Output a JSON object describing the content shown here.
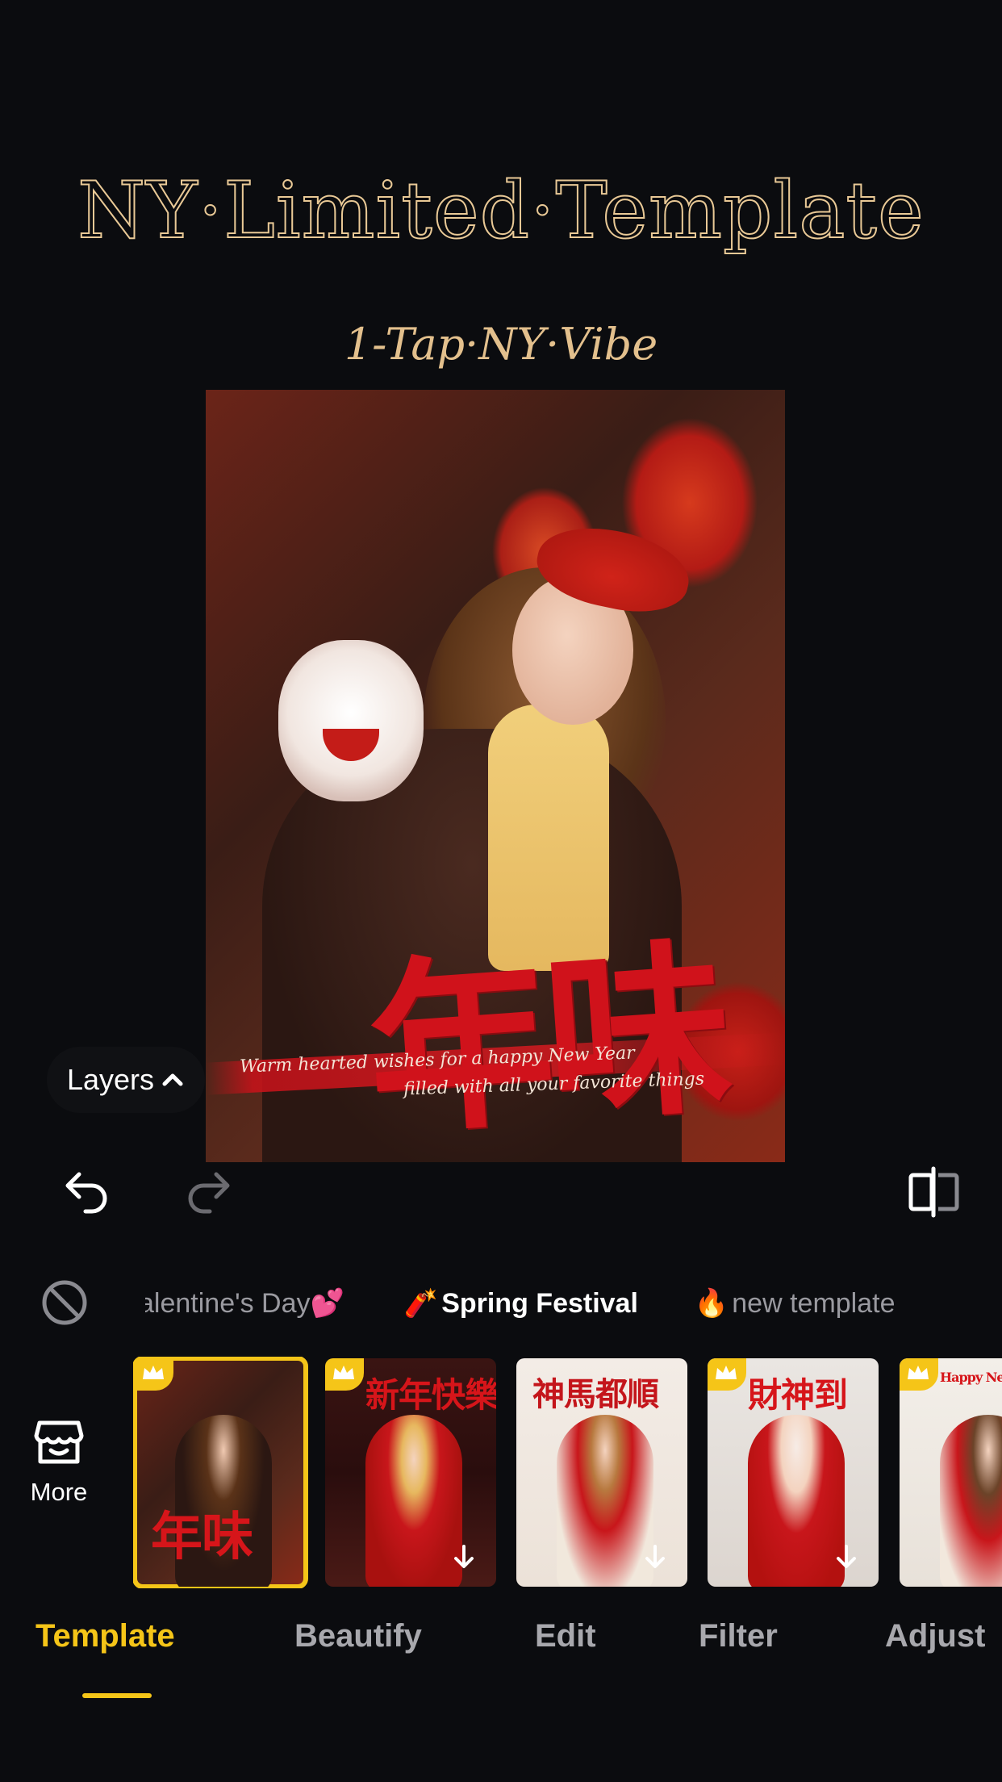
{
  "header": {
    "title": "NY·Limited·Template",
    "subtitle": "1-Tap·NY·Vibe"
  },
  "preview": {
    "calligraphy": "年味",
    "script_line_1": "Warm hearted wishes for a happy New Year",
    "script_line_2": "filled with all your favorite things"
  },
  "layers_button": {
    "label": "Layers",
    "icon": "chevron-up-icon"
  },
  "toolbar": {
    "undo_icon": "undo-icon",
    "redo_icon": "redo-icon",
    "compare_icon": "compare-icon"
  },
  "categories": {
    "none_icon": "no-filter-icon",
    "items": [
      {
        "label": "alentine's Day",
        "emoji": "💕",
        "emoji_position": "after"
      },
      {
        "label": "Spring Festival",
        "emoji": "🧨",
        "emoji_position": "before",
        "active": true
      },
      {
        "label": "new template",
        "emoji": "🔥",
        "emoji_position": "before"
      }
    ]
  },
  "templates": {
    "more_label": "More",
    "more_icon": "store-icon",
    "items": [
      {
        "title": "年味",
        "selected": true,
        "premium": true,
        "downloaded": true
      },
      {
        "title": "新年快樂",
        "selected": false,
        "premium": true,
        "downloaded": false
      },
      {
        "title": "神馬都順",
        "selected": false,
        "premium": false,
        "downloaded": false
      },
      {
        "title": "財神到",
        "selected": false,
        "premium": true,
        "downloaded": false
      },
      {
        "title": "Happy New Year!!",
        "selected": false,
        "premium": true,
        "downloaded": true
      }
    ]
  },
  "tabs": [
    {
      "label": "Template",
      "active": true
    },
    {
      "label": "Beautify",
      "active": false
    },
    {
      "label": "Edit",
      "active": false
    },
    {
      "label": "Filter",
      "active": false
    },
    {
      "label": "Adjust",
      "active": false
    }
  ],
  "colors": {
    "accent": "#f5c518",
    "background": "#0b0c0f",
    "title_gold": "#e9c996"
  }
}
